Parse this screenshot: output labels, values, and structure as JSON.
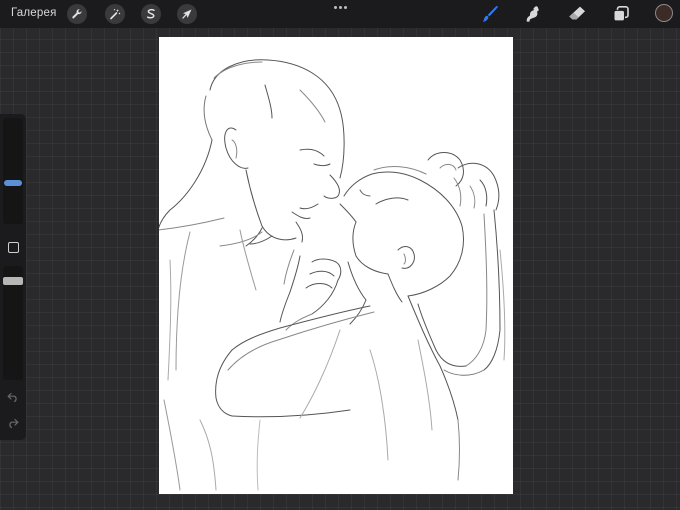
{
  "app": {
    "gallery_label": "Галерея"
  },
  "toolbar_left": [
    {
      "name": "actions",
      "icon": "wrench-icon"
    },
    {
      "name": "adjustments",
      "icon": "magic-wand-icon"
    },
    {
      "name": "selection",
      "icon": "selection-s-icon"
    },
    {
      "name": "transform",
      "icon": "arrow-cursor-icon"
    }
  ],
  "toolbar_right": [
    {
      "name": "brush",
      "icon": "brush-icon",
      "active": true
    },
    {
      "name": "smudge",
      "icon": "smudge-icon",
      "active": false
    },
    {
      "name": "eraser",
      "icon": "eraser-icon",
      "active": false
    },
    {
      "name": "layers",
      "icon": "layers-icon",
      "active": false
    }
  ],
  "colors": {
    "active_tool": "#2f7cf6",
    "current_color": "#3b2a26",
    "slider_size": "#5b8fd8",
    "slider_opacity": "#b6b6b6"
  },
  "sidebar": {
    "brush_size": 0.5,
    "brush_opacity": 1.0
  }
}
